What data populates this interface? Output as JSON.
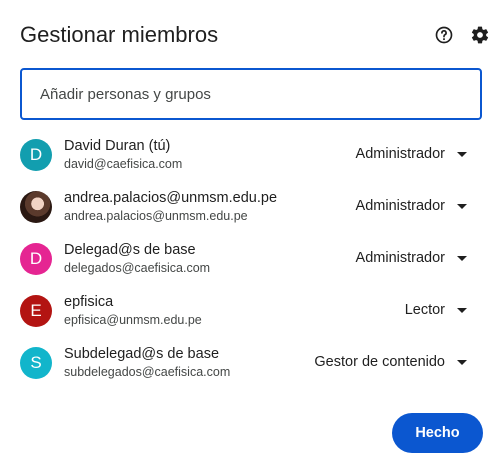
{
  "dialog": {
    "title": "Gestionar miembros",
    "help_icon": "help-circle-icon",
    "settings_icon": "gear-icon"
  },
  "add_input": {
    "placeholder": "Añadir personas y grupos",
    "value": ""
  },
  "members": [
    {
      "name": "David Duran (tú)",
      "email": "david@caefisica.com",
      "role": "Administrador",
      "avatar_letter": "D",
      "avatar_color": "#129eaf"
    },
    {
      "name": "andrea.palacios@unmsm.edu.pe",
      "email": "andrea.palacios@unmsm.edu.pe",
      "role": "Administrador",
      "avatar_letter": "",
      "avatar_color": "#5b3a2c"
    },
    {
      "name": "Delegad@s de base",
      "email": "delegados@caefisica.com",
      "role": "Administrador",
      "avatar_letter": "D",
      "avatar_color": "#e52592"
    },
    {
      "name": "epfisica",
      "email": "epfisica@unmsm.edu.pe",
      "role": "Lector",
      "avatar_letter": "E",
      "avatar_color": "#b31412"
    },
    {
      "name": "Subdelegad@s de base",
      "email": "subdelegados@caefisica.com",
      "role": "Gestor de contenido",
      "avatar_letter": "S",
      "avatar_color": "#12b5cb"
    }
  ],
  "actions": {
    "done_label": "Hecho"
  },
  "colors": {
    "accent": "#0b57d0",
    "text_primary": "#1f1f1f",
    "text_secondary": "#444746"
  }
}
